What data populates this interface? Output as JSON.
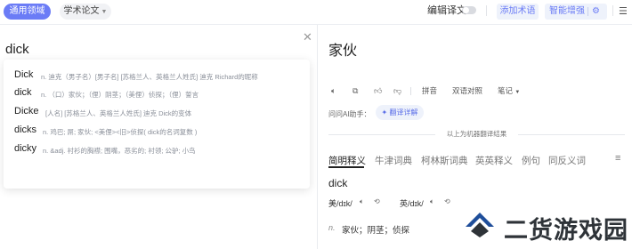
{
  "topbar": {
    "domain_label": "通用领域",
    "paper_label": "学术论文",
    "edit_label": "编辑译文",
    "add_term_label": "添加术语",
    "enhance_label": "智能增强"
  },
  "source": {
    "text": "dick",
    "suggestions": [
      {
        "word": "Dick",
        "definition": "n. 迪克（男子名）[男子名] [苏格兰人、英格兰人姓氏] 迪克 Richard的昵称"
      },
      {
        "word": "dick",
        "definition": "n. （口）家伙；（俚）阴茎；（美俚）侦探；（俚）誓言"
      },
      {
        "word": "Dicke",
        "definition": "[人名] [苏格兰人、英格兰人姓氏] 迪克 Dick的变体"
      },
      {
        "word": "dicks",
        "definition": "n. 鸡巴; 屌; 家伙; <美俚><旧>侦探( dick的名词复数 )"
      },
      {
        "word": "dicky",
        "definition": "n. &adj. 衬衫的胸襟; 围嘴，恶劣的; 衬领; 公驴; 小鸟"
      }
    ]
  },
  "target": {
    "text": "家伙",
    "tools": {
      "pinyin": "拼音",
      "bilingual": "双语对照",
      "notes": "笔记"
    },
    "ai_label": "问问AI助手：",
    "ai_button": "翻译详解",
    "mt_note": "以上为机器翻译结果",
    "tabs": [
      "简明释义",
      "牛津词典",
      "柯林斯词典",
      "英英释义",
      "例句",
      "同反义词"
    ],
    "headword": "dick",
    "pron_us": "美/dɪk/",
    "pron_uk": "英/dɪk/",
    "pos": "n.",
    "meaning": "家伙；阴茎；侦探"
  },
  "watermark": {
    "text": "二货游戏园"
  },
  "colors": {
    "accent": "#6b7cf6",
    "accent_bg": "#eef2fb"
  }
}
